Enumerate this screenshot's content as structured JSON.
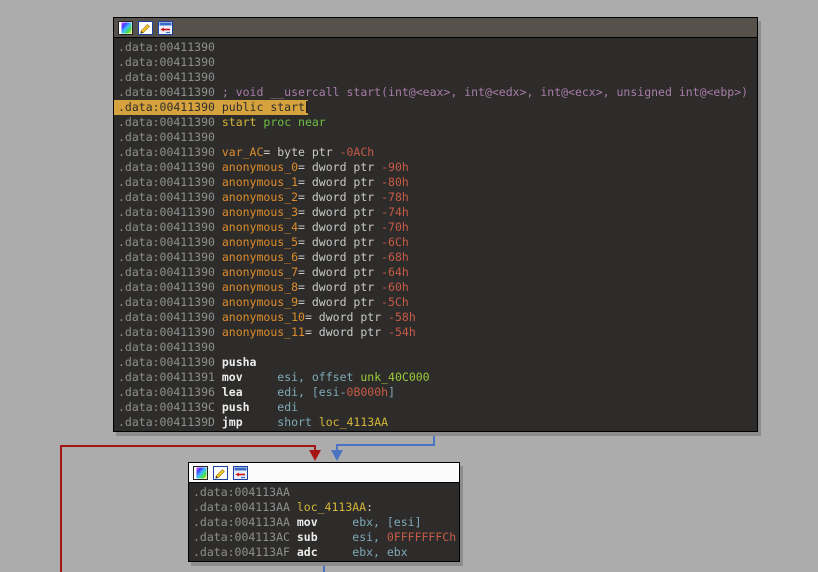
{
  "app": {
    "view": "graph-view"
  },
  "colors": {
    "canvas_bg": "#ACACAC",
    "node_bg": "#2D2C2A",
    "node_title_dark": "#56524B",
    "node_title_light": "#FBFBFB",
    "highlight_bg": "#D6A23E",
    "edge_red": "#A61414",
    "edge_blue": "#4A73C4"
  },
  "title_icons": [
    "node-color-palette-icon",
    "edit-node-icon",
    "group-nodes-icon"
  ],
  "nodes": [
    {
      "id": "start",
      "label": "basic block .data:00411390 (start)",
      "lines": [
        {
          "tokens": [
            {
              "t": ".data:00411390",
              "c": "addr"
            }
          ]
        },
        {
          "tokens": [
            {
              "t": ".data:00411390",
              "c": "addr"
            }
          ]
        },
        {
          "tokens": [
            {
              "t": ".data:00411390",
              "c": "addr"
            }
          ]
        },
        {
          "tokens": [
            {
              "t": ".data:00411390 ",
              "c": "addr"
            },
            {
              "t": "; void __usercall start(int@<eax>, int@<edx>, int@<ecx>, unsigned int@<ebp>)",
              "c": "comment"
            }
          ]
        },
        {
          "hl": true,
          "cursor": true,
          "tokens": [
            {
              "t": ".data:00411390 public start",
              "c": "hl"
            }
          ]
        },
        {
          "tokens": [
            {
              "t": ".data:00411390 ",
              "c": "addr"
            },
            {
              "t": "start",
              "c": "name"
            },
            {
              "t": " ",
              "c": "plain"
            },
            {
              "t": "proc near",
              "c": "kw"
            }
          ]
        },
        {
          "tokens": [
            {
              "t": ".data:00411390",
              "c": "addr"
            }
          ]
        },
        {
          "tokens": [
            {
              "t": ".data:00411390 ",
              "c": "addr"
            },
            {
              "t": "var_AC",
              "c": "var"
            },
            {
              "t": "= byte ptr ",
              "c": "plain"
            },
            {
              "t": "-0ACh",
              "c": "num"
            }
          ]
        },
        {
          "tokens": [
            {
              "t": ".data:00411390 ",
              "c": "addr"
            },
            {
              "t": "anonymous_0",
              "c": "var"
            },
            {
              "t": "= dword ptr ",
              "c": "plain"
            },
            {
              "t": "-90h",
              "c": "num"
            }
          ]
        },
        {
          "tokens": [
            {
              "t": ".data:00411390 ",
              "c": "addr"
            },
            {
              "t": "anonymous_1",
              "c": "var"
            },
            {
              "t": "= dword ptr ",
              "c": "plain"
            },
            {
              "t": "-80h",
              "c": "num"
            }
          ]
        },
        {
          "tokens": [
            {
              "t": ".data:00411390 ",
              "c": "addr"
            },
            {
              "t": "anonymous_2",
              "c": "var"
            },
            {
              "t": "= dword ptr ",
              "c": "plain"
            },
            {
              "t": "-78h",
              "c": "num"
            }
          ]
        },
        {
          "tokens": [
            {
              "t": ".data:00411390 ",
              "c": "addr"
            },
            {
              "t": "anonymous_3",
              "c": "var"
            },
            {
              "t": "= dword ptr ",
              "c": "plain"
            },
            {
              "t": "-74h",
              "c": "num"
            }
          ]
        },
        {
          "tokens": [
            {
              "t": ".data:00411390 ",
              "c": "addr"
            },
            {
              "t": "anonymous_4",
              "c": "var"
            },
            {
              "t": "= dword ptr ",
              "c": "plain"
            },
            {
              "t": "-70h",
              "c": "num"
            }
          ]
        },
        {
          "tokens": [
            {
              "t": ".data:00411390 ",
              "c": "addr"
            },
            {
              "t": "anonymous_5",
              "c": "var"
            },
            {
              "t": "= dword ptr ",
              "c": "plain"
            },
            {
              "t": "-6Ch",
              "c": "num"
            }
          ]
        },
        {
          "tokens": [
            {
              "t": ".data:00411390 ",
              "c": "addr"
            },
            {
              "t": "anonymous_6",
              "c": "var"
            },
            {
              "t": "= dword ptr ",
              "c": "plain"
            },
            {
              "t": "-68h",
              "c": "num"
            }
          ]
        },
        {
          "tokens": [
            {
              "t": ".data:00411390 ",
              "c": "addr"
            },
            {
              "t": "anonymous_7",
              "c": "var"
            },
            {
              "t": "= dword ptr ",
              "c": "plain"
            },
            {
              "t": "-64h",
              "c": "num"
            }
          ]
        },
        {
          "tokens": [
            {
              "t": ".data:00411390 ",
              "c": "addr"
            },
            {
              "t": "anonymous_8",
              "c": "var"
            },
            {
              "t": "= dword ptr ",
              "c": "plain"
            },
            {
              "t": "-60h",
              "c": "num"
            }
          ]
        },
        {
          "tokens": [
            {
              "t": ".data:00411390 ",
              "c": "addr"
            },
            {
              "t": "anonymous_9",
              "c": "var"
            },
            {
              "t": "= dword ptr ",
              "c": "plain"
            },
            {
              "t": "-5Ch",
              "c": "num"
            }
          ]
        },
        {
          "tokens": [
            {
              "t": ".data:00411390 ",
              "c": "addr"
            },
            {
              "t": "anonymous_10",
              "c": "var"
            },
            {
              "t": "= dword ptr ",
              "c": "plain"
            },
            {
              "t": "-58h",
              "c": "num"
            }
          ]
        },
        {
          "tokens": [
            {
              "t": ".data:00411390 ",
              "c": "addr"
            },
            {
              "t": "anonymous_11",
              "c": "var"
            },
            {
              "t": "= dword ptr ",
              "c": "plain"
            },
            {
              "t": "-54h",
              "c": "num"
            }
          ]
        },
        {
          "tokens": [
            {
              "t": ".data:00411390",
              "c": "addr"
            }
          ]
        },
        {
          "tokens": [
            {
              "t": ".data:00411390 ",
              "c": "addr"
            },
            {
              "t": "pusha",
              "c": "mnem"
            }
          ]
        },
        {
          "tokens": [
            {
              "t": ".data:00411391 ",
              "c": "addr"
            },
            {
              "t": "mov",
              "c": "mnem"
            },
            {
              "t": "     ",
              "c": "plain"
            },
            {
              "t": "esi, offset ",
              "c": "reg"
            },
            {
              "t": "unk_40C000",
              "c": "gname"
            }
          ]
        },
        {
          "tokens": [
            {
              "t": ".data:00411396 ",
              "c": "addr"
            },
            {
              "t": "lea",
              "c": "mnem"
            },
            {
              "t": "     ",
              "c": "plain"
            },
            {
              "t": "edi, [esi-",
              "c": "reg"
            },
            {
              "t": "0B000h",
              "c": "num"
            },
            {
              "t": "]",
              "c": "reg"
            }
          ]
        },
        {
          "tokens": [
            {
              "t": ".data:0041139C ",
              "c": "addr"
            },
            {
              "t": "push",
              "c": "mnem"
            },
            {
              "t": "    ",
              "c": "plain"
            },
            {
              "t": "edi",
              "c": "reg"
            }
          ]
        },
        {
          "tokens": [
            {
              "t": ".data:0041139D ",
              "c": "addr"
            },
            {
              "t": "jmp",
              "c": "mnem"
            },
            {
              "t": "     ",
              "c": "plain"
            },
            {
              "t": "short ",
              "c": "reg"
            },
            {
              "t": "loc_4113AA",
              "c": "name"
            }
          ]
        }
      ]
    },
    {
      "id": "loc_4113AA",
      "label": "basic block .data:004113AA (loc_4113AA)",
      "lines": [
        {
          "tokens": [
            {
              "t": ".data:004113AA",
              "c": "addr"
            }
          ]
        },
        {
          "tokens": [
            {
              "t": ".data:004113AA ",
              "c": "addr"
            },
            {
              "t": "loc_4113AA",
              "c": "name"
            },
            {
              "t": ":",
              "c": "plain"
            }
          ]
        },
        {
          "tokens": [
            {
              "t": ".data:004113AA ",
              "c": "addr"
            },
            {
              "t": "mov",
              "c": "mnem"
            },
            {
              "t": "     ",
              "c": "plain"
            },
            {
              "t": "ebx, [esi]",
              "c": "reg"
            }
          ]
        },
        {
          "tokens": [
            {
              "t": ".data:004113AC ",
              "c": "addr"
            },
            {
              "t": "sub",
              "c": "mnem"
            },
            {
              "t": "     ",
              "c": "plain"
            },
            {
              "t": "esi, ",
              "c": "reg"
            },
            {
              "t": "0FFFFFFFCh",
              "c": "num"
            }
          ]
        },
        {
          "tokens": [
            {
              "t": ".data:004113AF ",
              "c": "addr"
            },
            {
              "t": "adc",
              "c": "mnem"
            },
            {
              "t": "     ",
              "c": "plain"
            },
            {
              "t": "ebx, ebx",
              "c": "reg"
            }
          ]
        }
      ]
    }
  ],
  "edges": [
    {
      "id": "loopback-red",
      "color": "#A61414"
    },
    {
      "id": "jmp-blue-in",
      "color": "#4A73C4"
    },
    {
      "id": "fallthrough-blue-out",
      "color": "#4A73C4"
    }
  ]
}
